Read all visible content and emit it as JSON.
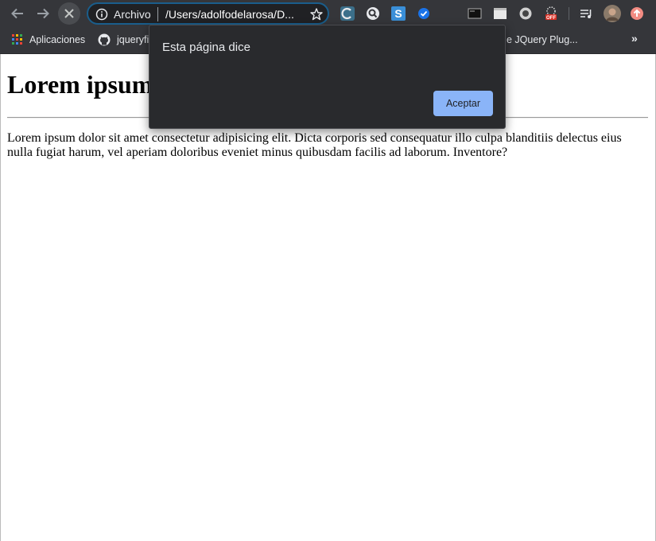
{
  "browser": {
    "omnibox": {
      "scheme_label": "Archivo",
      "url": "/Users/adolfodelarosa/D..."
    },
    "bookmarks": [
      {
        "label": "Aplicaciones",
        "icon": "apps-grid-icon"
      },
      {
        "label": "jqueryfi",
        "icon": "github-icon"
      },
      {
        "label": "e JQuery Plug...",
        "icon": ""
      }
    ],
    "extensions": [
      "extension-c-icon",
      "extension-search-icon",
      "extension-s-icon",
      "extension-check-icon",
      "extension-terminal-icon",
      "extension-window-icon",
      "extension-record-icon",
      "extension-off-icon",
      "reading-list-icon",
      "profile-avatar",
      "update-icon"
    ]
  },
  "page": {
    "heading": "Lorem ipsum",
    "paragraph": "Lorem ipsum dolor sit amet consectetur adipisicing elit. Dicta corporis sed consequatur illo culpa blanditiis delectus eius nulla fugiat harum, vel aperiam doloribus eveniet minus quibusdam facilis ad laborum. Inventore?"
  },
  "dialog": {
    "title": "Esta página dice",
    "ok_label": "Aceptar"
  },
  "colors": {
    "chrome": "#35363a",
    "dialog_bg": "#292a2d",
    "accent": "#8ab4f8"
  }
}
